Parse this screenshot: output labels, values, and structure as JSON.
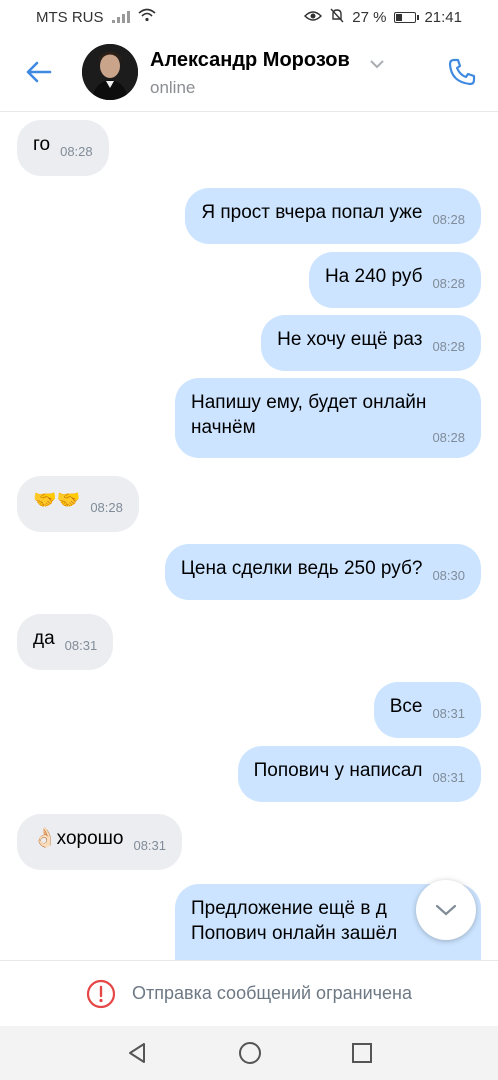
{
  "status_bar": {
    "carrier": "MTS RUS",
    "battery_percent": "27 %",
    "battery_level": 0.27,
    "time": "21:41"
  },
  "header": {
    "back_icon": "arrow-left-icon",
    "contact_name": "Александр Морозов",
    "presence": "online",
    "call_icon": "phone-icon",
    "accent_color": "#2a5885"
  },
  "messages": [
    {
      "dir": "in",
      "text": "го",
      "time": "08:28"
    },
    {
      "dir": "out",
      "text": "Я прост вчера попал уже",
      "time": "08:28"
    },
    {
      "dir": "out",
      "text": "На 240 руб",
      "time": "08:28"
    },
    {
      "dir": "out",
      "text": "Не хочу ещё раз",
      "time": "08:28"
    },
    {
      "dir": "out",
      "text_line1": "Напишу ему, будет онлайн",
      "text_line2": "начнём",
      "time": "08:28"
    },
    {
      "dir": "in",
      "text": "🤝🤝",
      "time": "08:28"
    },
    {
      "dir": "out",
      "text": "Цена сделки ведь 250 руб?",
      "time": "08:30"
    },
    {
      "dir": "in",
      "text": "да",
      "time": "08:31"
    },
    {
      "dir": "out",
      "text": "Все",
      "time": "08:31"
    },
    {
      "dir": "out",
      "text": "Попович у написал",
      "time": "08:31"
    },
    {
      "dir": "in",
      "text": "👌🏻хорошо",
      "time": "08:31"
    },
    {
      "dir": "out",
      "text_line1": "Предложение ещё в д",
      "text_line2": "Попович онлайн зашёл"
    }
  ],
  "restriction": {
    "icon": "alert-circle-icon",
    "text": "Отправка сообщений ограничена"
  },
  "nav": {
    "back": "nav-back-icon",
    "home": "nav-home-icon",
    "recents": "nav-recents-icon"
  },
  "colors": {
    "incoming_bubble": "#ebedf0",
    "outgoing_bubble": "#cce4ff",
    "alert_red": "#e64646"
  }
}
